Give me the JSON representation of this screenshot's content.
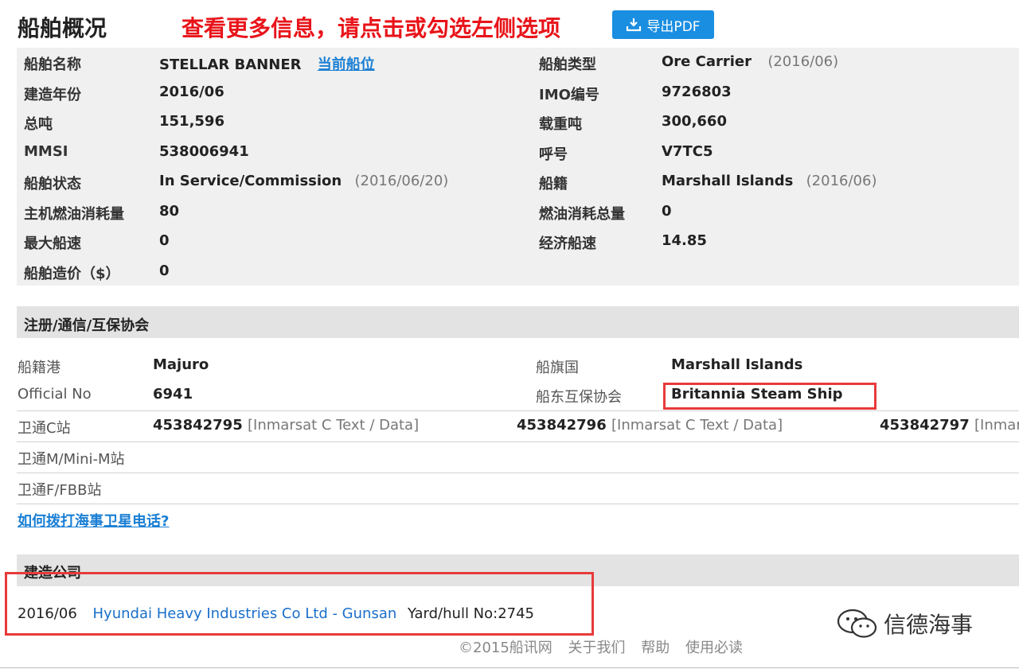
{
  "header": {
    "title": "船舶概况",
    "notice": "查看更多信息，请点击或勾选左侧选项",
    "export_label": "导出PDF"
  },
  "overview": {
    "left": [
      {
        "label": "船舶名称",
        "value": "STELLAR BANNER",
        "link": "当前船位"
      },
      {
        "label": "建造年份",
        "value": "2016/06"
      },
      {
        "label": "总吨",
        "value": "151,596"
      },
      {
        "label": "MMSI",
        "value": "538006941"
      },
      {
        "label": "船舶状态",
        "value": "In Service/Commission",
        "note": "(2016/06/20)"
      },
      {
        "label": "主机燃油消耗量",
        "value": "80"
      },
      {
        "label": "最大船速",
        "value": "0"
      },
      {
        "label": "船舶造价（$）",
        "value": "0"
      }
    ],
    "right": [
      {
        "label": "船舶类型",
        "value": "Ore Carrier",
        "note": "(2016/06)"
      },
      {
        "label": "IMO编号",
        "value": "9726803"
      },
      {
        "label": "载重吨",
        "value": "300,660"
      },
      {
        "label": "呼号",
        "value": "V7TC5"
      },
      {
        "label": "船籍",
        "value": "Marshall Islands",
        "note": "(2016/06)"
      },
      {
        "label": "燃油消耗总量",
        "value": "0"
      },
      {
        "label": "经济船速",
        "value": "14.85"
      }
    ]
  },
  "registration": {
    "title": "注册/通信/互保协会",
    "port_label": "船籍港",
    "port_value": "Majuro",
    "flag_label": "船旗国",
    "flag_value": "Marshall Islands",
    "official_label": "Official No",
    "official_value": "6941",
    "pi_label": "船东互保协会",
    "pi_value": "Britannia Steam Ship",
    "inmc_label": "卫通C站",
    "inmc": [
      {
        "number": "453842795",
        "type": "[Inmarsat C Text / Data]"
      },
      {
        "number": "453842796",
        "type": "[Inmarsat C Text / Data]"
      },
      {
        "number": "453842797",
        "type": "[Inmars"
      }
    ],
    "inmm_label": "卫通M/Mini-M站",
    "inmf_label": "卫通F/FBB站",
    "help_link": "如何拨打海事卫星电话?"
  },
  "builder": {
    "title": "建造公司",
    "date": "2016/06",
    "company": "Hyundai Heavy Industries Co Ltd - Gunsan",
    "hull": "Yard/hull No:2745"
  },
  "footer": {
    "copyright": "©2015船讯网",
    "about": "关于我们",
    "help": "帮助",
    "terms": "使用必读"
  },
  "watermark": {
    "text": "信德海事"
  },
  "colors": {
    "accent": "#1a8ee1",
    "notice": "#e8141a",
    "highlight": "#e83a3a"
  }
}
